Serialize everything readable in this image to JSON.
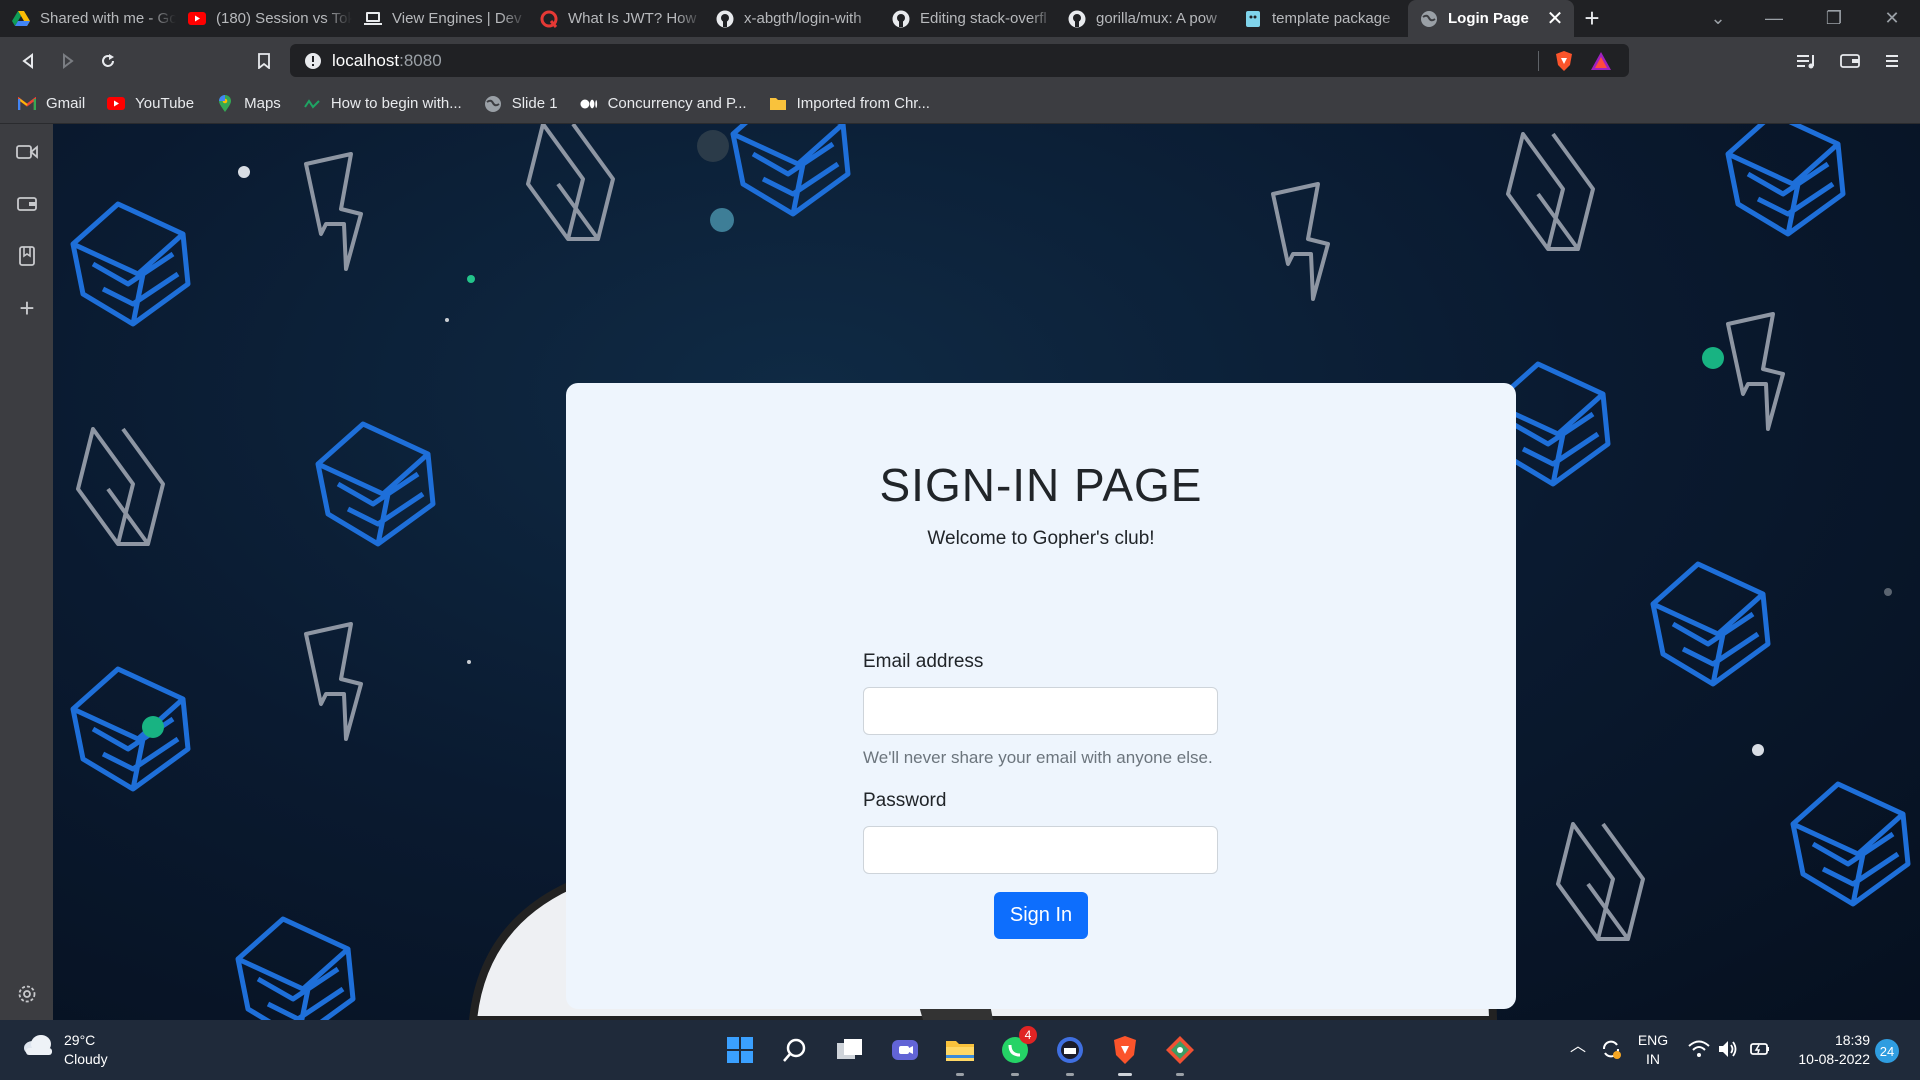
{
  "browser": {
    "tabs": [
      {
        "title": "Shared with me - Go",
        "icon": "google-drive-icon"
      },
      {
        "title": "(180) Session vs Tok",
        "icon": "youtube-icon"
      },
      {
        "title": "View Engines | Dev",
        "icon": "laptop-icon"
      },
      {
        "title": "What Is JWT? How",
        "icon": "quora-icon"
      },
      {
        "title": "x-abgth/login-with",
        "icon": "github-icon"
      },
      {
        "title": "Editing stack-overfl",
        "icon": "github-icon"
      },
      {
        "title": "gorilla/mux: A pow",
        "icon": "github-icon"
      },
      {
        "title": "template package",
        "icon": "go-doc-icon"
      },
      {
        "title": "Login Page",
        "icon": "globe-icon",
        "active": true
      }
    ],
    "address": {
      "host": "localhost",
      "port": ":8080"
    },
    "bookmarks": [
      {
        "label": "Gmail",
        "icon": "gmail-icon"
      },
      {
        "label": "YouTube",
        "icon": "youtube-icon"
      },
      {
        "label": "Maps",
        "icon": "maps-icon"
      },
      {
        "label": "How to begin with...",
        "icon": "link-icon"
      },
      {
        "label": "Slide 1",
        "icon": "globe-icon"
      },
      {
        "label": "Concurrency and P...",
        "icon": "medium-icon"
      },
      {
        "label": "Imported from Chr...",
        "icon": "folder-icon"
      }
    ]
  },
  "login": {
    "title": "SIGN-IN PAGE",
    "subtitle": "Welcome to Gopher's club!",
    "email_label": "Email address",
    "email_value": "",
    "email_hint": "We'll never share your email with anyone else.",
    "password_label": "Password",
    "password_value": "",
    "submit_label": "Sign In"
  },
  "taskbar": {
    "weather_temp": "29°C",
    "weather_desc": "Cloudy",
    "whatsapp_badge": "4",
    "lang_top": "ENG",
    "lang_bottom": "IN",
    "time": "18:39",
    "date": "10-08-2022",
    "notification_count": "24"
  },
  "colors": {
    "accent": "#0d6efd",
    "card_bg": "#eef5fd",
    "page_bg": "#0a1a30",
    "icon_blue": "#1e6fd9",
    "icon_gray": "#8e96a3"
  }
}
